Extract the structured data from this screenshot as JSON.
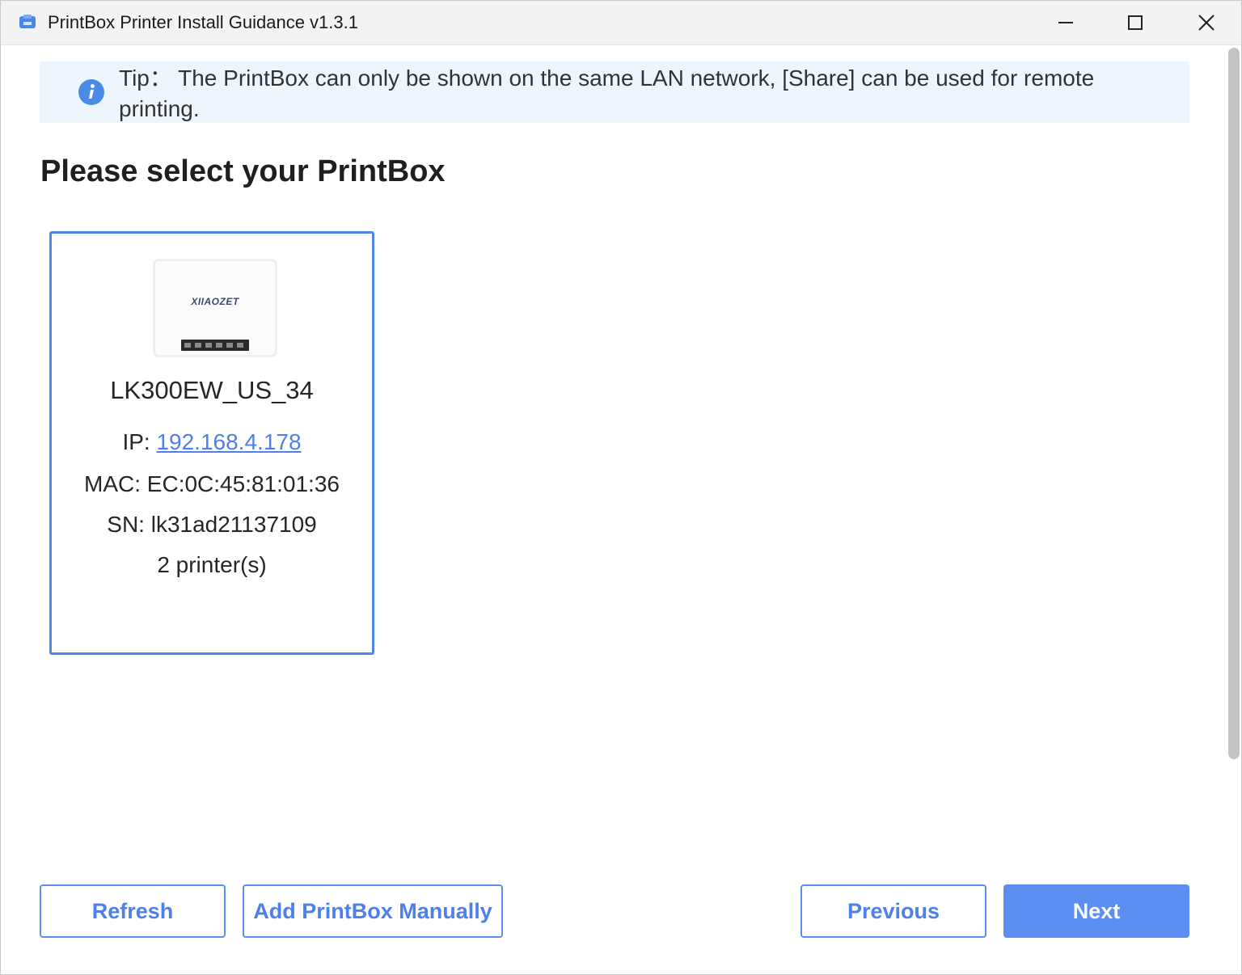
{
  "window": {
    "title": "PrintBox Printer Install Guidance v1.3.1"
  },
  "tip": {
    "text": "Tip： The PrintBox can only be shown on the same LAN network, [Share] can be used for remote printing."
  },
  "heading": "Please select your PrintBox",
  "printbox": {
    "brand": "XIIAOZET",
    "name": "LK300EW_US_34",
    "ip_label": "IP: ",
    "ip": "192.168.4.178",
    "mac": "MAC: EC:0C:45:81:01:36",
    "sn": "SN: lk31ad21137109",
    "printers": "2 printer(s)"
  },
  "buttons": {
    "refresh": "Refresh",
    "add_manual": "Add PrintBox Manually",
    "previous": "Previous",
    "next": "Next"
  },
  "colors": {
    "accent": "#5b8ef0",
    "tip_background": "#eef6fd",
    "link": "#4f7fe8"
  }
}
